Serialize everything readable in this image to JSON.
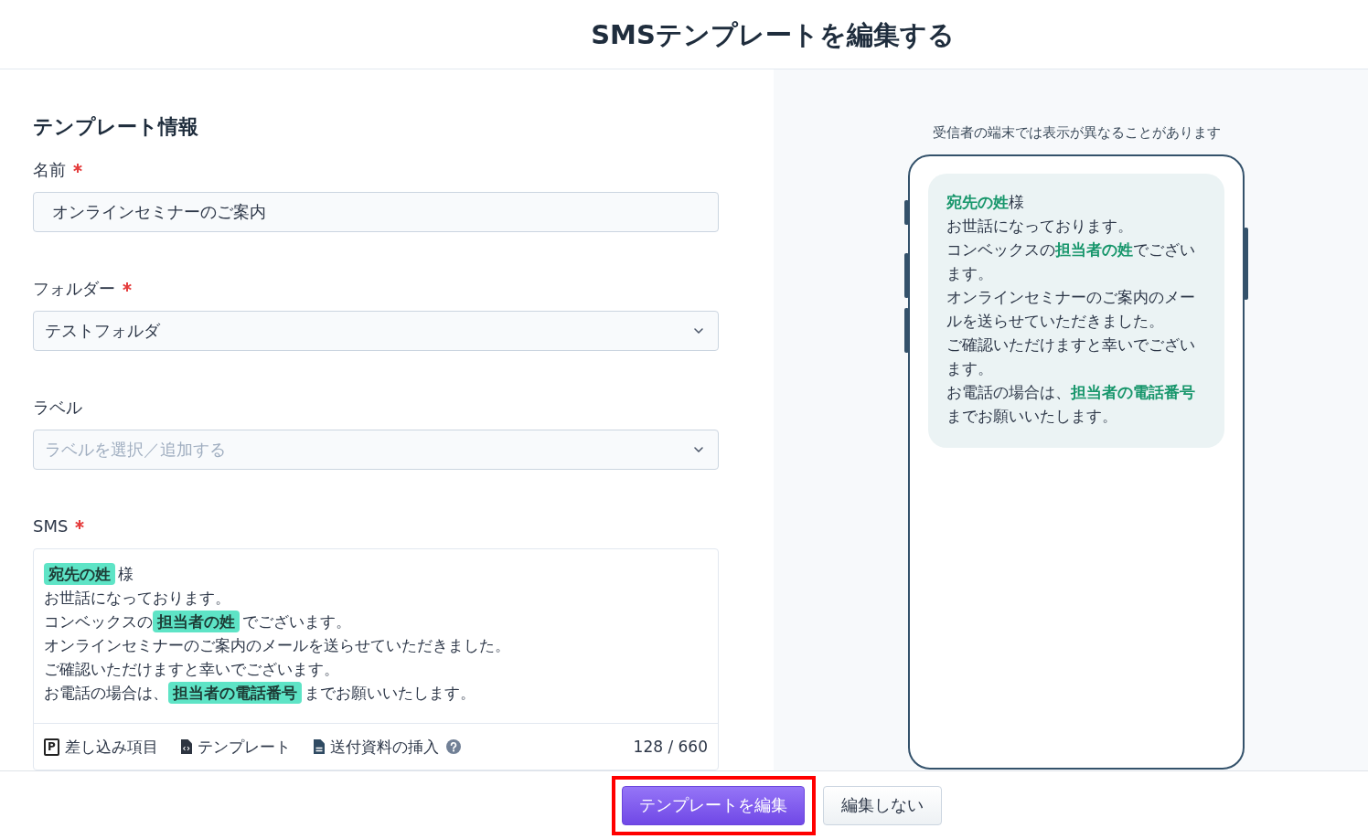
{
  "header": {
    "title": "SMSテンプレートを編集する"
  },
  "form": {
    "heading": "テンプレート情報",
    "fields": [
      {
        "kind": "text",
        "label": "名前",
        "required": true,
        "value": "オンラインセミナーのご案内"
      },
      {
        "kind": "select",
        "label": "フォルダー",
        "required": true,
        "value": "テストフォルダ"
      },
      {
        "kind": "select",
        "label": "ラベル",
        "required": false,
        "placeholder": "ラベルを選択／追加する"
      }
    ],
    "sms": {
      "label": "SMS",
      "required": true,
      "lines": [
        "**宛先の姓**様",
        "お世話になっております。",
        "コンベックスの**担当者の姓**でございます。",
        "オンラインセミナーのご案内のメールを送らせていただきました。",
        "ご確認いただけますと幸いでございます。",
        "お電話の場合は、**担当者の電話番号**までお願いいたします。"
      ],
      "toolbar": [
        {
          "kind": "field",
          "icon_text": "P",
          "label": "差し込み項目",
          "help": false
        },
        {
          "kind": "template",
          "label": "テンプレート",
          "help": false
        },
        {
          "kind": "attachment",
          "label": "送付資料の挿入",
          "help": true
        }
      ],
      "counter": "128 / 660"
    }
  },
  "preview": {
    "note": "受信者の端末では表示が異なることがあります",
    "paragraphs": [
      "**宛先の姓**様",
      "お世話になっております。",
      "コンベックスの**担当者の姓**でございます。",
      "オンラインセミナーのご案内のメールを送らせていただきました。",
      "ご確認いただけますと幸いでございます。",
      "お電話の場合は、**担当者の電話番号**までお願いいたします。"
    ]
  },
  "footer": {
    "buttons": [
      {
        "kind": "primary",
        "label": "テンプレートを編集",
        "highlighted": true
      },
      {
        "kind": "secondary",
        "label": "編集しない",
        "highlighted": false
      }
    ]
  }
}
